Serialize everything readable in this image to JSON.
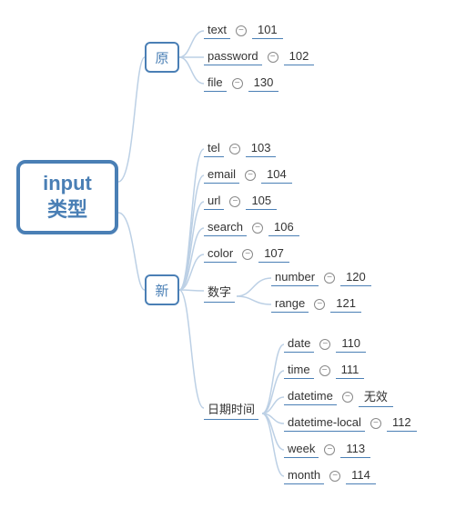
{
  "root": {
    "line1": "input",
    "line2": "类型"
  },
  "categories": {
    "original": {
      "label": "原"
    },
    "new": {
      "label": "新"
    }
  },
  "original_items": [
    {
      "label": "text",
      "value": "101"
    },
    {
      "label": "password",
      "value": "102"
    },
    {
      "label": "file",
      "value": "130"
    }
  ],
  "new_items": [
    {
      "label": "tel",
      "value": "103"
    },
    {
      "label": "email",
      "value": "104"
    },
    {
      "label": "url",
      "value": "105"
    },
    {
      "label": "search",
      "value": "106"
    },
    {
      "label": "color",
      "value": "107"
    }
  ],
  "numeric": {
    "label": "数字",
    "items": [
      {
        "label": "number",
        "value": "120"
      },
      {
        "label": "range",
        "value": "121"
      }
    ]
  },
  "datetime": {
    "label": "日期时间",
    "items": [
      {
        "label": "date",
        "value": "110"
      },
      {
        "label": "time",
        "value": "111"
      },
      {
        "label": "datetime",
        "value": "无效"
      },
      {
        "label": "datetime-local",
        "value": "112"
      },
      {
        "label": "week",
        "value": "113"
      },
      {
        "label": "month",
        "value": "114"
      }
    ]
  },
  "chart_data": {
    "type": "mindmap",
    "title": "input 类型",
    "root": "input 类型",
    "children": [
      {
        "label": "原",
        "children": [
          {
            "label": "text",
            "value": 101
          },
          {
            "label": "password",
            "value": 102
          },
          {
            "label": "file",
            "value": 130
          }
        ]
      },
      {
        "label": "新",
        "children": [
          {
            "label": "tel",
            "value": 103
          },
          {
            "label": "email",
            "value": 104
          },
          {
            "label": "url",
            "value": 105
          },
          {
            "label": "search",
            "value": 106
          },
          {
            "label": "color",
            "value": 107
          },
          {
            "label": "数字",
            "children": [
              {
                "label": "number",
                "value": 120
              },
              {
                "label": "range",
                "value": 121
              }
            ]
          },
          {
            "label": "日期时间",
            "children": [
              {
                "label": "date",
                "value": 110
              },
              {
                "label": "time",
                "value": 111
              },
              {
                "label": "datetime",
                "value": "无效"
              },
              {
                "label": "datetime-local",
                "value": 112
              },
              {
                "label": "week",
                "value": 113
              },
              {
                "label": "month",
                "value": 114
              }
            ]
          }
        ]
      }
    ]
  }
}
